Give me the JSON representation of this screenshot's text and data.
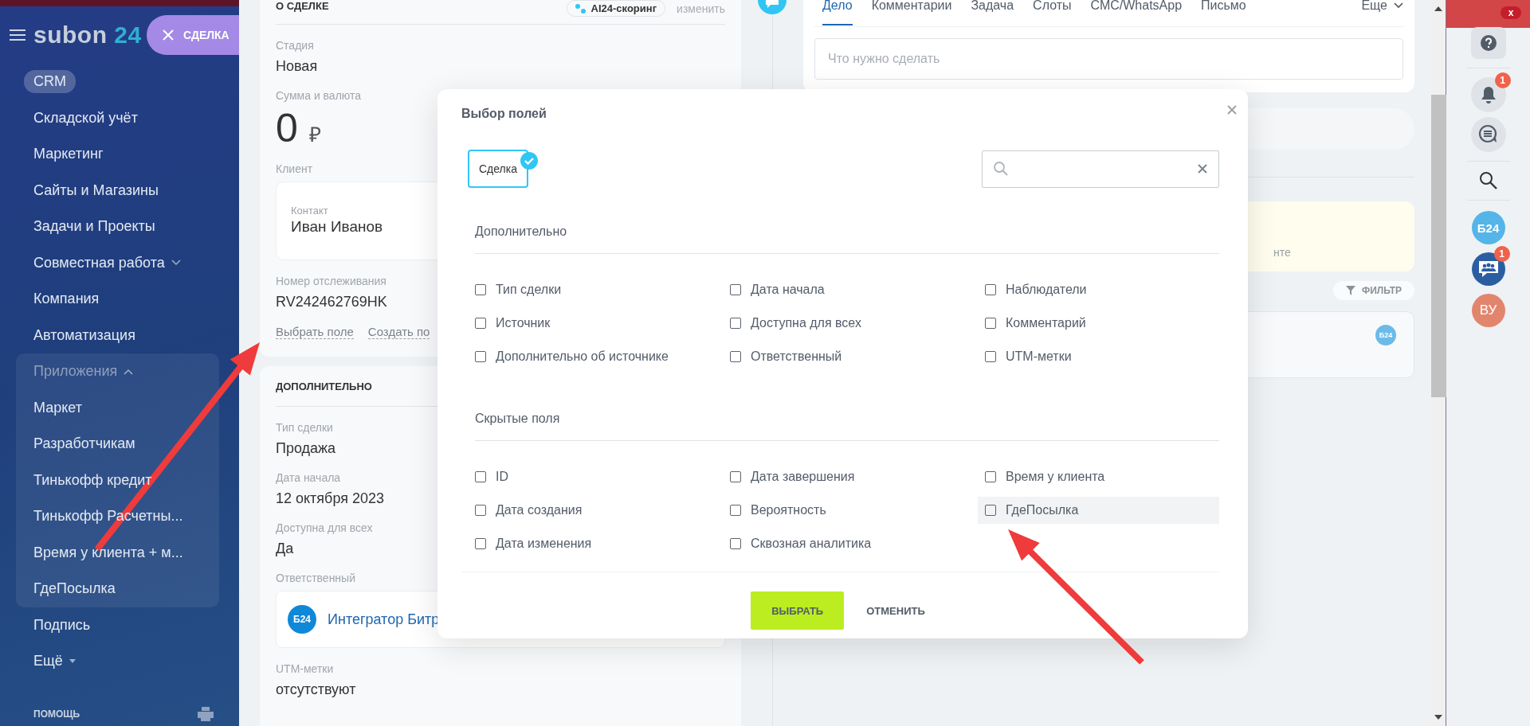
{
  "sidebar": {
    "logo": "subon",
    "logo_suffix": "24",
    "deal_button": "СДЕЛКА",
    "items": [
      {
        "label": "CRM",
        "selected": true
      },
      {
        "label": "Складской учёт",
        "selected": false
      },
      {
        "label": "Маркетинг",
        "selected": false
      },
      {
        "label": "Сайты и Магазины",
        "selected": false
      },
      {
        "label": "Задачи и Проекты",
        "selected": false
      },
      {
        "label": "Совместная работа",
        "selected": false,
        "expanded": false
      },
      {
        "label": "Компания",
        "selected": false
      },
      {
        "label": "Автоматизация",
        "selected": false
      }
    ],
    "group": {
      "label": "Приложения",
      "expanded": true,
      "items": [
        {
          "label": "Маркет",
          "selected": false
        },
        {
          "label": "Разработчикам",
          "selected": false
        },
        {
          "label": "Тинькофф кредит",
          "selected": false
        },
        {
          "label": "Тинькофф Расчетны...",
          "selected": false
        },
        {
          "label": "Время у клиента + м...",
          "selected": false
        },
        {
          "label": "ГдеПосылка",
          "selected": false
        }
      ]
    },
    "items_after": [
      {
        "label": "Подпись",
        "selected": false
      },
      {
        "label": "Ещё",
        "selected": false,
        "expanded": false
      }
    ],
    "help": "ПОМОЩЬ"
  },
  "deal_card": {
    "title": "О СДЕЛКЕ",
    "scoring": "AI24-скоринг",
    "edit": "изменить",
    "fields": [
      {
        "kind": "text",
        "label": "Стадия",
        "value": "Новая"
      },
      {
        "kind": "money",
        "label": "Сумма и валюта",
        "value": "0",
        "currency": "₽"
      },
      {
        "kind": "contact",
        "label": "Клиент",
        "contact_label": "Контакт",
        "value": "Иван Иванов"
      },
      {
        "kind": "text",
        "label": "Номер отслеживания",
        "value": "RV242462769HK"
      }
    ],
    "links": [
      "Выбрать поле",
      "Создать по"
    ]
  },
  "extra_card": {
    "title": "ДОПОЛНИТЕЛЬНО",
    "fields": [
      {
        "kind": "text",
        "label": "Тип сделки",
        "value": "Продажа"
      },
      {
        "kind": "text",
        "label": "Дата начала",
        "value": "12 октября 2023"
      },
      {
        "kind": "text",
        "label": "Доступна для всех",
        "value": "Да"
      },
      {
        "kind": "user",
        "label": "Ответственный",
        "avatar": "Б24",
        "value": "Интегратор Битр"
      },
      {
        "kind": "text",
        "label": "UTM-метки",
        "value": "отсутствуют"
      }
    ]
  },
  "activity": {
    "tabs": [
      {
        "label": "Дело",
        "selected": true
      },
      {
        "label": "Комментарии",
        "selected": false
      },
      {
        "label": "Задача",
        "selected": false
      },
      {
        "label": "Слоты",
        "selected": false
      },
      {
        "label": "СМС/WhatsApp",
        "selected": false
      },
      {
        "label": "Письмо",
        "selected": false
      }
    ],
    "more": "Еще",
    "placeholder": "Что нужно сделать",
    "notice": "нте",
    "filter": "ФИЛЬТР",
    "entry_badge": "Б24"
  },
  "right_panel": {
    "alert_badge": "x",
    "bell_badge": "1",
    "avatar": "Б24",
    "chat_badge": "1",
    "user": "ВУ"
  },
  "modal": {
    "title": "Выбор полей",
    "entity": {
      "label": "Сделка",
      "selected": true
    },
    "sections": [
      {
        "title": "Дополнительно",
        "fields": [
          {
            "label": "Тип сделки",
            "checked": false,
            "hovered": false
          },
          {
            "label": "Дата начала",
            "checked": false,
            "hovered": false
          },
          {
            "label": "Наблюдатели",
            "checked": false,
            "hovered": false
          },
          {
            "label": "Источник",
            "checked": false,
            "hovered": false
          },
          {
            "label": "Доступна для всех",
            "checked": false,
            "hovered": false
          },
          {
            "label": "Комментарий",
            "checked": false,
            "hovered": false
          },
          {
            "label": "Дополнительно об источнике",
            "checked": false,
            "hovered": false
          },
          {
            "label": "Ответственный",
            "checked": false,
            "hovered": false
          },
          {
            "label": "UTM-метки",
            "checked": false,
            "hovered": false
          }
        ]
      },
      {
        "title": "Скрытые поля",
        "fields": [
          {
            "label": "ID",
            "checked": false,
            "hovered": false
          },
          {
            "label": "Дата завершения",
            "checked": false,
            "hovered": false
          },
          {
            "label": "Время у клиента",
            "checked": false,
            "hovered": false
          },
          {
            "label": "Дата создания",
            "checked": false,
            "hovered": false
          },
          {
            "label": "Вероятность",
            "checked": false,
            "hovered": false
          },
          {
            "label": "ГдеПосылка",
            "checked": false,
            "hovered": true
          },
          {
            "label": "Дата изменения",
            "checked": false,
            "hovered": false
          },
          {
            "label": "Сквозная аналитика",
            "checked": false,
            "hovered": false
          }
        ]
      }
    ],
    "buttons": {
      "primary": "ВЫБРАТЬ",
      "secondary": "ОТМЕНИТЬ"
    }
  }
}
